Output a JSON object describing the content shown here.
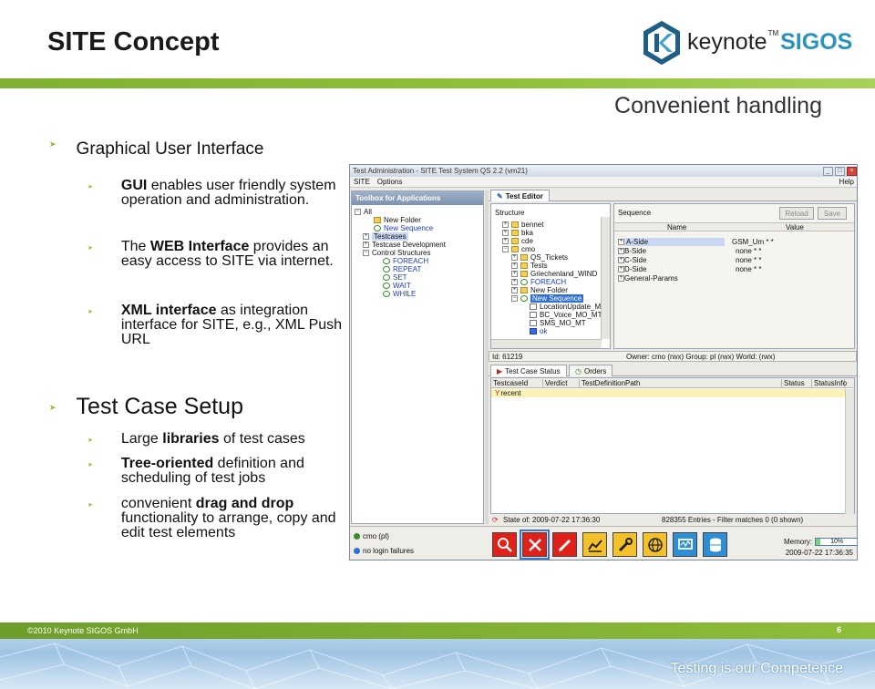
{
  "slide": {
    "title": "SITE Concept",
    "subtitle": "Convenient handling",
    "copyright": "©2010 Keynote SIGOS GmbH",
    "page_number": "6",
    "tagline": "Testing is our Competence"
  },
  "logo": {
    "word": "keynote",
    "tm": "TM",
    "brand": "SIGOS"
  },
  "bullets": {
    "gui_heading": "Graphical User Interface",
    "gui_items": [
      {
        "bold": "GUI",
        "rest": " enables user friendly system operation and administration."
      },
      {
        "pre": "The ",
        "bold": "WEB Interface",
        "rest": " provides an easy access to SITE via internet."
      },
      {
        "bold": "XML interface",
        "rest": " as integration interface for SITE, e.g., XML Push URL"
      }
    ],
    "setup_heading": "Test Case Setup",
    "setup_items": [
      {
        "pre": "Large ",
        "bold": "libraries",
        "rest": " of test cases"
      },
      {
        "bold": "Tree-oriented",
        "rest": " definition and scheduling of test jobs"
      },
      {
        "pre": "convenient ",
        "bold": "drag and drop",
        "rest": " functionality to arrange, copy and edit test elements"
      }
    ]
  },
  "app": {
    "window_title": "Test Administration - SITE Test System QS 2.2 (vm21)",
    "menu": [
      "SITE",
      "Options"
    ],
    "help": "Help",
    "toolbox_title": "Toolbox for Applications",
    "toolbox_tree": [
      "All",
      "New Folder",
      "New Sequence",
      "Testcases",
      "Testcase Development",
      "Control Structures",
      "FOREACH",
      "REPEAT",
      "SET",
      "WAIT",
      "WHILE"
    ],
    "tab_test_editor": "Test Editor",
    "structure_label": "Structure",
    "structure_tree": [
      "bennet",
      "bka",
      "cde",
      "cmo",
      "QS_Tickets",
      "Tests",
      "Griechenland_WIND",
      "FOREACH",
      "New Folder",
      "New Sequence",
      "LocationUpdate_MPt",
      "BC_Voice_MO_MT",
      "SMS_MO_MT",
      "ok"
    ],
    "sequence_label": "Sequence",
    "reload_label": "Reload",
    "save_label": "Save",
    "seq_columns": [
      "Name",
      "Value"
    ],
    "seq_rows": [
      {
        "name": "A-Side",
        "value": "GSM_Um * *"
      },
      {
        "name": "B-Side",
        "value": "none * *"
      },
      {
        "name": "C-Side",
        "value": "none * *"
      },
      {
        "name": "D-Side",
        "value": "none * *"
      },
      {
        "name": "General-Params",
        "value": ""
      }
    ],
    "id_text": "Id: 61219",
    "owner_text": "Owner: cmo (rwx)  Group: pl (rwx)  World: (rwx)",
    "tab_status": "Test Case Status",
    "tab_orders": "Orders",
    "status_columns": [
      "TestcaseId",
      "Verdict",
      "TestDefinitionPath",
      "Status",
      "StatusInfo"
    ],
    "recent_label": "recent",
    "state_text": "State of: 2009-07-22 17:36:30",
    "entries_text": "828355 Entries - Filter matches 0 (0 shown)",
    "user_text": "cmo (pl)",
    "login_text": "no login failures",
    "memory_label": "Memory:",
    "memory_value": "10%",
    "memory_fraction": 0.1,
    "footer_date": "2009-07-22 17:36:35",
    "launcher_icons": [
      "search-icon",
      "tools-icon",
      "edit-icon",
      "chart-icon",
      "wrench-icon",
      "globe-icon",
      "monitor-icon",
      "database-icon"
    ]
  }
}
